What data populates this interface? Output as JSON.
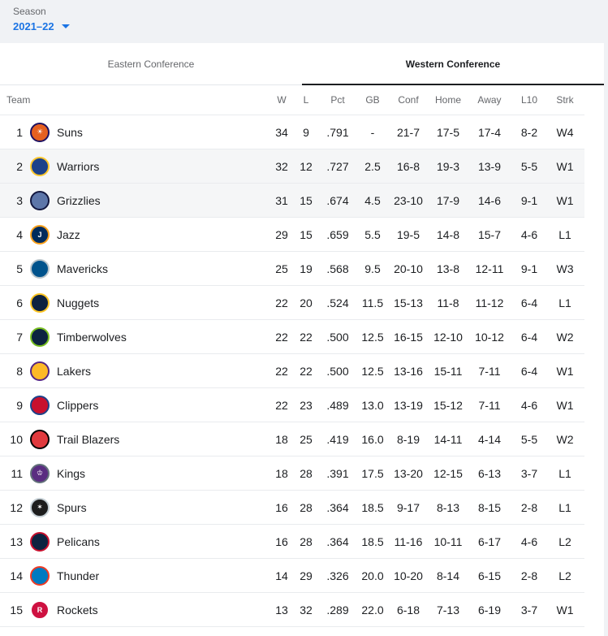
{
  "season": {
    "label": "Season",
    "value": "2021–22"
  },
  "tabs": [
    {
      "label": "Eastern Conference",
      "active": false
    },
    {
      "label": "Western Conference",
      "active": true
    }
  ],
  "columns": [
    "Team",
    "W",
    "L",
    "Pct",
    "GB",
    "Conf",
    "Home",
    "Away",
    "L10",
    "Strk"
  ],
  "rows": [
    {
      "rank": "1",
      "team": "Suns",
      "w": "34",
      "l": "9",
      "pct": ".791",
      "gb": "-",
      "conf": "21-7",
      "home": "17-5",
      "away": "17-4",
      "l10": "8-2",
      "strk": "W4",
      "logo": {
        "icon": "suns-logo-icon",
        "color": "#e56020",
        "ring": "#1d1160",
        "glyph": "☀"
      }
    },
    {
      "rank": "2",
      "team": "Warriors",
      "w": "32",
      "l": "12",
      "pct": ".727",
      "gb": "2.5",
      "conf": "16-8",
      "home": "19-3",
      "away": "13-9",
      "l10": "5-5",
      "strk": "W1",
      "logo": {
        "icon": "warriors-logo-icon",
        "color": "#1d428a",
        "ring": "#ffc72c",
        "glyph": ""
      }
    },
    {
      "rank": "3",
      "team": "Grizzlies",
      "w": "31",
      "l": "15",
      "pct": ".674",
      "gb": "4.5",
      "conf": "23-10",
      "home": "17-9",
      "away": "14-6",
      "l10": "9-1",
      "strk": "W1",
      "logo": {
        "icon": "grizzlies-logo-icon",
        "color": "#5d76a9",
        "ring": "#12173f",
        "glyph": ""
      }
    },
    {
      "rank": "4",
      "team": "Jazz",
      "w": "29",
      "l": "15",
      "pct": ".659",
      "gb": "5.5",
      "conf": "19-5",
      "home": "14-8",
      "away": "15-7",
      "l10": "4-6",
      "strk": "L1",
      "logo": {
        "icon": "jazz-logo-icon",
        "color": "#002b5c",
        "ring": "#f9a01b",
        "glyph": "J"
      }
    },
    {
      "rank": "5",
      "team": "Mavericks",
      "w": "25",
      "l": "19",
      "pct": ".568",
      "gb": "9.5",
      "conf": "20-10",
      "home": "13-8",
      "away": "12-11",
      "l10": "9-1",
      "strk": "W3",
      "logo": {
        "icon": "mavericks-logo-icon",
        "color": "#00538c",
        "ring": "#b8c4ca",
        "glyph": ""
      }
    },
    {
      "rank": "6",
      "team": "Nuggets",
      "w": "22",
      "l": "20",
      "pct": ".524",
      "gb": "11.5",
      "conf": "15-13",
      "home": "11-8",
      "away": "11-12",
      "l10": "6-4",
      "strk": "L1",
      "logo": {
        "icon": "nuggets-logo-icon",
        "color": "#0e2240",
        "ring": "#fec524",
        "glyph": ""
      }
    },
    {
      "rank": "7",
      "team": "Timberwolves",
      "w": "22",
      "l": "22",
      "pct": ".500",
      "gb": "12.5",
      "conf": "16-15",
      "home": "12-10",
      "away": "10-12",
      "l10": "6-4",
      "strk": "W2",
      "logo": {
        "icon": "timberwolves-logo-icon",
        "color": "#0c2340",
        "ring": "#78be20",
        "glyph": ""
      }
    },
    {
      "rank": "8",
      "team": "Lakers",
      "w": "22",
      "l": "22",
      "pct": ".500",
      "gb": "12.5",
      "conf": "13-16",
      "home": "15-11",
      "away": "7-11",
      "l10": "6-4",
      "strk": "W1",
      "logo": {
        "icon": "lakers-logo-icon",
        "color": "#fdb927",
        "ring": "#552583",
        "glyph": ""
      }
    },
    {
      "rank": "9",
      "team": "Clippers",
      "w": "22",
      "l": "23",
      "pct": ".489",
      "gb": "13.0",
      "conf": "13-19",
      "home": "15-12",
      "away": "7-11",
      "l10": "4-6",
      "strk": "W1",
      "logo": {
        "icon": "clippers-logo-icon",
        "color": "#c8102e",
        "ring": "#1d428a",
        "glyph": ""
      }
    },
    {
      "rank": "10",
      "team": "Trail Blazers",
      "w": "18",
      "l": "25",
      "pct": ".419",
      "gb": "16.0",
      "conf": "8-19",
      "home": "14-11",
      "away": "4-14",
      "l10": "5-5",
      "strk": "W2",
      "logo": {
        "icon": "trail-blazers-logo-icon",
        "color": "#e03a3e",
        "ring": "#000000",
        "glyph": ""
      }
    },
    {
      "rank": "11",
      "team": "Kings",
      "w": "18",
      "l": "28",
      "pct": ".391",
      "gb": "17.5",
      "conf": "13-20",
      "home": "12-15",
      "away": "6-13",
      "l10": "3-7",
      "strk": "L1",
      "logo": {
        "icon": "kings-logo-icon",
        "color": "#5a2d81",
        "ring": "#63727a",
        "glyph": "♔"
      }
    },
    {
      "rank": "12",
      "team": "Spurs",
      "w": "16",
      "l": "28",
      "pct": ".364",
      "gb": "18.5",
      "conf": "9-17",
      "home": "8-13",
      "away": "8-15",
      "l10": "2-8",
      "strk": "L1",
      "logo": {
        "icon": "spurs-logo-icon",
        "color": "#1d1d1d",
        "ring": "#c4ced4",
        "glyph": "✶"
      }
    },
    {
      "rank": "13",
      "team": "Pelicans",
      "w": "16",
      "l": "28",
      "pct": ".364",
      "gb": "18.5",
      "conf": "11-16",
      "home": "10-11",
      "away": "6-17",
      "l10": "4-6",
      "strk": "L2",
      "logo": {
        "icon": "pelicans-logo-icon",
        "color": "#0c2340",
        "ring": "#c8102e",
        "glyph": ""
      }
    },
    {
      "rank": "14",
      "team": "Thunder",
      "w": "14",
      "l": "29",
      "pct": ".326",
      "gb": "20.0",
      "conf": "10-20",
      "home": "8-14",
      "away": "6-15",
      "l10": "2-8",
      "strk": "L2",
      "logo": {
        "icon": "thunder-logo-icon",
        "color": "#007ac1",
        "ring": "#ef3b24",
        "glyph": ""
      }
    },
    {
      "rank": "15",
      "team": "Rockets",
      "w": "13",
      "l": "32",
      "pct": ".289",
      "gb": "22.0",
      "conf": "6-18",
      "home": "7-13",
      "away": "6-19",
      "l10": "3-7",
      "strk": "W1",
      "logo": {
        "icon": "rockets-logo-icon",
        "color": "#ce1141",
        "ring": "#ffffff",
        "glyph": "R"
      }
    }
  ]
}
